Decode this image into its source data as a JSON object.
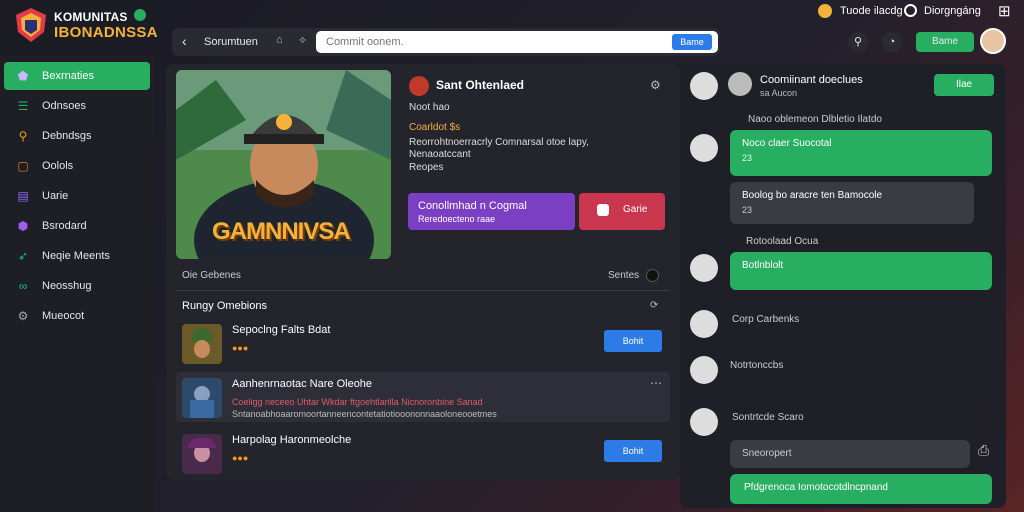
{
  "brand": {
    "line1": "KOMUNITAS",
    "line2": "IBONADNSSA"
  },
  "topbar": {
    "item1": "Tuode ilacdg",
    "item2": "Diorgngáng",
    "menu_icon": "grid-icon"
  },
  "search": {
    "back": "‹",
    "label": "Sorumtuen",
    "placeholder": "Commit oonem.",
    "button": "Bame"
  },
  "header_actions": {
    "button": "Bame"
  },
  "sidebar": {
    "items": [
      {
        "label": "Bexrnaties",
        "icon": "home-icon",
        "active": true
      },
      {
        "label": "Odnsoes",
        "icon": "list-icon"
      },
      {
        "label": "Debndsgs",
        "icon": "search-icon"
      },
      {
        "label": "Oolols",
        "icon": "box-icon"
      },
      {
        "label": "Uarie",
        "icon": "cart-icon"
      },
      {
        "label": "Bsrodard",
        "icon": "shield-icon"
      },
      {
        "label": "Neqie Meents",
        "icon": "rocket-icon"
      },
      {
        "label": "Neosshug",
        "icon": "link-icon"
      },
      {
        "label": "Mueocot",
        "icon": "settings-icon"
      }
    ]
  },
  "game": {
    "art_text": "GAMNNIVSA",
    "title": "Sant Ohtenlaed",
    "meta1": "Noot hao",
    "meta2": "Coarldot $s",
    "desc1": "Reorrohtnoerracrly Comnarsal otoe lapy,",
    "desc2": "Nenaoatccant",
    "meta3": "Reopes",
    "primary_btn_line1": "Conollmhad n Cogmal",
    "primary_btn_line2": "Reredoecteno raae",
    "secondary_btn": "Garie",
    "section_left": "Oie Gebenes",
    "section_right": "Sentes"
  },
  "recent": {
    "heading": "Rungy Omebions",
    "rows": [
      {
        "title": "Sepoclng Falts Bdat",
        "action": "Bohit",
        "emojis": "●●●"
      },
      {
        "title": "Aanhenrnaotac Nare Oleohe",
        "line1": "Coeligg neceeo Uhtar Wkdar ftgoehtlarilla Nicnoronbine Sanad",
        "line2": "Sntanoabhoaaromoortanneencontetatiotiooononnaaoloneooetmes"
      },
      {
        "title": "Harpolag Haronmeolche",
        "action": "Bohit",
        "emojis": "●●●"
      }
    ]
  },
  "chat": {
    "header_title": "Coomiinant doeclues",
    "header_sub": "sa Aucon",
    "header_button": "Ilae",
    "tag1": "Naoo oblemeon Dlbletio Ilatdo",
    "bubble1_title": "Noco claer  Suocotal",
    "bubble1_sub": "23",
    "bubble2_title": "Boolog bo aracre ten Bamocole",
    "bubble2_sub": "23",
    "tag2": "Rotoolaad Ocua",
    "bubble3": "Botlnblolt",
    "line1": "Corp Carbenks",
    "line2": "Notrtonccbs",
    "tag3": "Sontrtcde Scaro",
    "input_placeholder": "Sneoropert",
    "bottom_bubble": "Pfdgrenoca     Iomotocotdlncpnand"
  },
  "colors": {
    "accent": "#27ae60",
    "blue": "#2d7be6",
    "purple": "#7b3fc4",
    "red": "#c9364e",
    "gold": "#f3b23a"
  }
}
